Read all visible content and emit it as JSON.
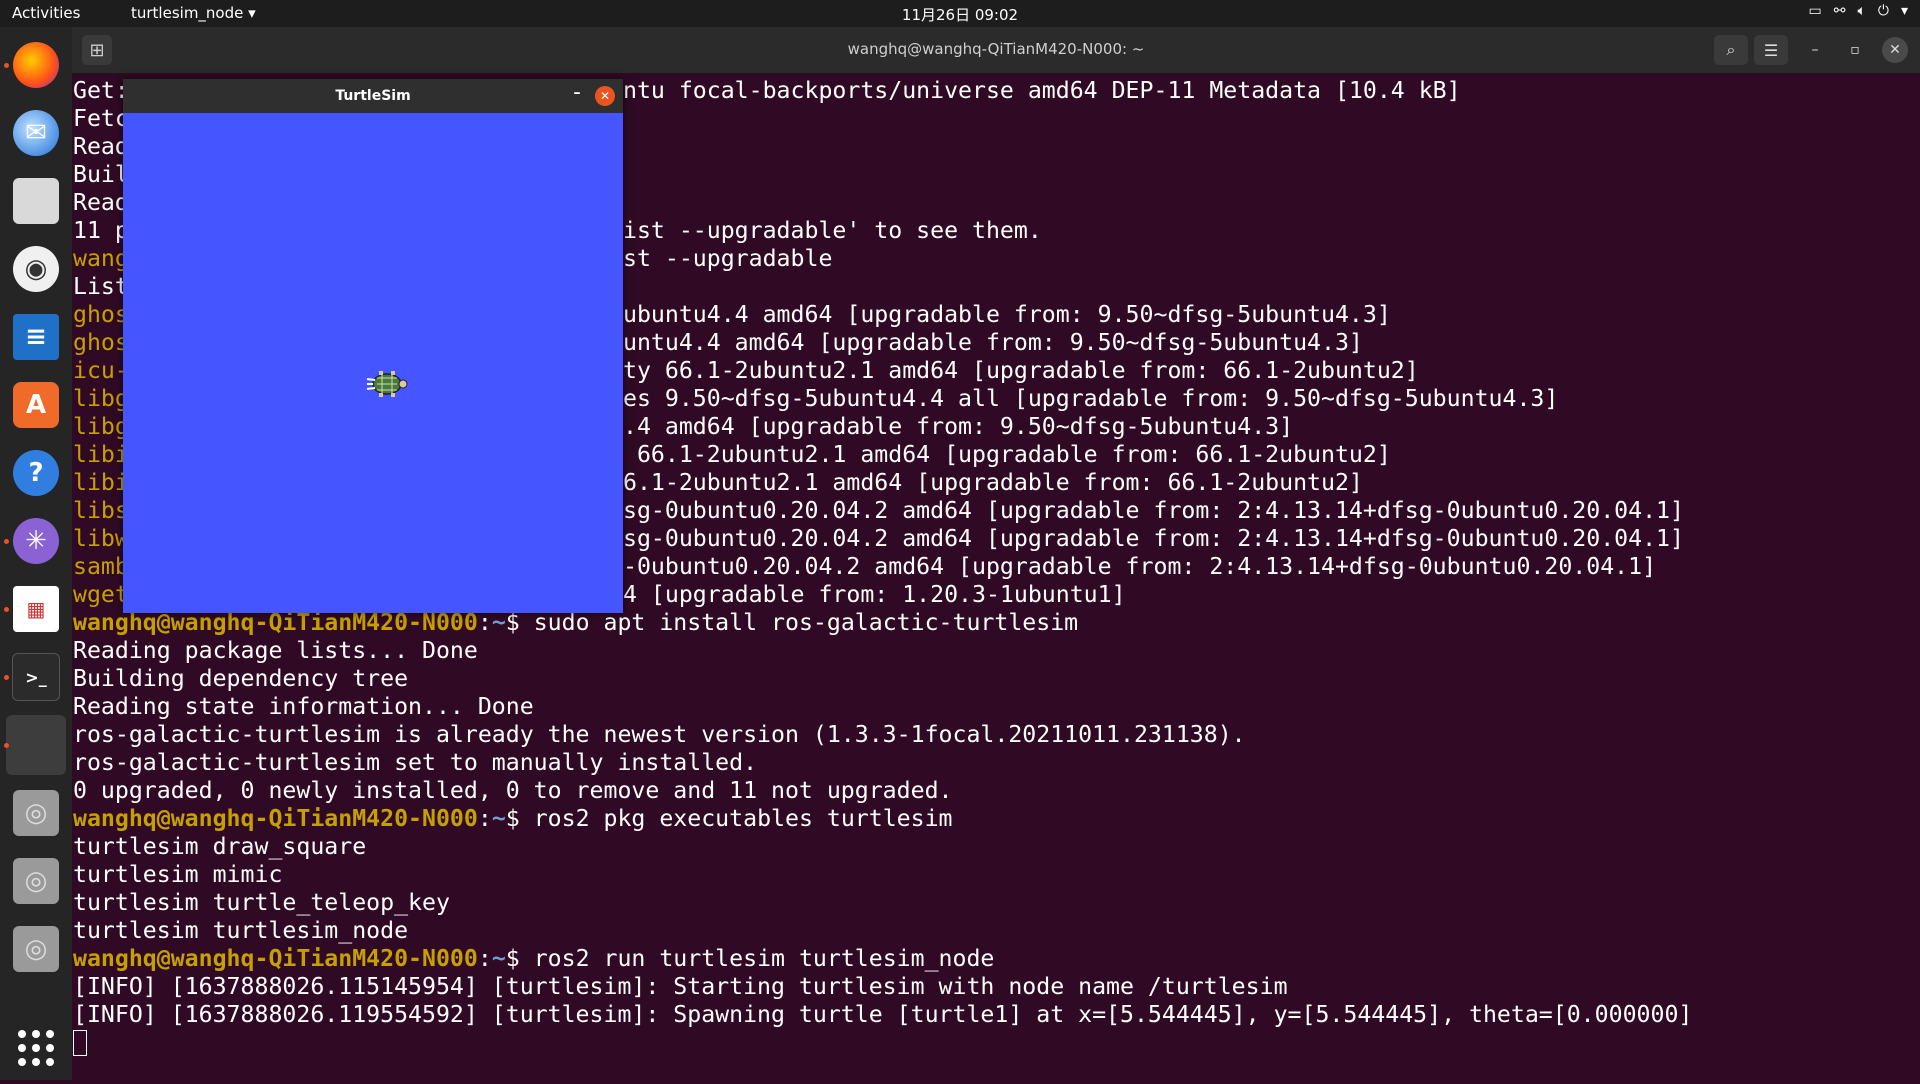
{
  "topbar": {
    "activities": "Activities",
    "app_menu": "turtlesim_node ▾",
    "clock": "11月26日  09:02"
  },
  "terminal": {
    "title": "wanghq@wanghq-QiTianM420-N000: ~",
    "prompt_user": "wanghq@wanghq-QiTianM420-N000",
    "prompt_path": "~",
    "lines_partial": [
      {
        "left": "Get:",
        "right": "ntu focal-backports/universe amd64 DEP-11 Metadata [10.4 kB]"
      },
      {
        "left": "Fetc",
        "right": ""
      },
      {
        "left": "Read",
        "right": ""
      },
      {
        "left": "Buil",
        "right": ""
      },
      {
        "left": "Read",
        "right": ""
      },
      {
        "left": "11 p",
        "right": "ist --upgradable' to see them."
      },
      {
        "left": "wang",
        "right": "st --upgradable",
        "warn": true
      },
      {
        "left": "List",
        "right": ""
      },
      {
        "left": "ghos",
        "right": "ubuntu4.4 amd64 [upgradable from: 9.50~dfsg-5ubuntu4.3]",
        "warn": true
      },
      {
        "left": "ghos",
        "right": "untu4.4 amd64 [upgradable from: 9.50~dfsg-5ubuntu4.3]",
        "warn": true
      },
      {
        "left": "icu-",
        "right": "ty 66.1-2ubuntu2.1 amd64 [upgradable from: 66.1-2ubuntu2]",
        "warn": true
      },
      {
        "left": "libg",
        "right": "es 9.50~dfsg-5ubuntu4.4 all [upgradable from: 9.50~dfsg-5ubuntu4.3]",
        "warn": true
      },
      {
        "left": "libg",
        "right": ".4 amd64 [upgradable from: 9.50~dfsg-5ubuntu4.3]",
        "warn": true
      },
      {
        "left": "libi",
        "right": " 66.1-2ubuntu2.1 amd64 [upgradable from: 66.1-2ubuntu2]",
        "warn": true
      },
      {
        "left": "libi",
        "right": "6.1-2ubuntu2.1 amd64 [upgradable from: 66.1-2ubuntu2]",
        "warn": true
      },
      {
        "left": "libs",
        "right": "sg-0ubuntu0.20.04.2 amd64 [upgradable from: 2:4.13.14+dfsg-0ubuntu0.20.04.1]",
        "warn": true
      },
      {
        "left": "libw",
        "right": "sg-0ubuntu0.20.04.2 amd64 [upgradable from: 2:4.13.14+dfsg-0ubuntu0.20.04.1]",
        "warn": true
      },
      {
        "left": "samb",
        "right": "-0ubuntu0.20.04.2 amd64 [upgradable from: 2:4.13.14+dfsg-0ubuntu0.20.04.1]",
        "warn": true
      },
      {
        "left": "wget",
        "right": "4 [upgradable from: 1.20.3-1ubuntu1]",
        "warn": true
      }
    ],
    "lines_full": [
      {
        "cmd": "sudo apt install ros-galactic-turtlesim",
        "prompt": true
      },
      {
        "text": "Reading package lists... Done"
      },
      {
        "text": "Building dependency tree"
      },
      {
        "text": "Reading state information... Done"
      },
      {
        "text": "ros-galactic-turtlesim is already the newest version (1.3.3-1focal.20211011.231138)."
      },
      {
        "text": "ros-galactic-turtlesim set to manually installed."
      },
      {
        "text": "0 upgraded, 0 newly installed, 0 to remove and 11 not upgraded."
      },
      {
        "cmd": "ros2 pkg executables turtlesim",
        "prompt": true
      },
      {
        "text": "turtlesim draw_square"
      },
      {
        "text": "turtlesim mimic"
      },
      {
        "text": "turtlesim turtle_teleop_key"
      },
      {
        "text": "turtlesim turtlesim_node"
      },
      {
        "cmd": "ros2 run turtlesim turtlesim_node",
        "prompt": true
      },
      {
        "text": "[INFO] [1637888026.115145954] [turtlesim]: Starting turtlesim with node name /turtlesim"
      },
      {
        "text": "[INFO] [1637888026.119554592] [turtlesim]: Spawning turtle [turtle1] at x=[5.544445], y=[5.544445], theta=[0.000000]"
      }
    ]
  },
  "turtlesim": {
    "title": "TurtleSim",
    "bg_color": "#4555ff"
  },
  "dock": {
    "items": [
      "firefox-icon",
      "thunderbird-icon",
      "files-icon",
      "rhythmbox-icon",
      "writer-icon",
      "software-icon",
      "help-icon",
      "network-icon",
      "document-viewer-icon",
      "terminal-icon",
      "turtlesim-app-icon",
      "disk-icon",
      "disk-icon",
      "disk-icon"
    ]
  }
}
